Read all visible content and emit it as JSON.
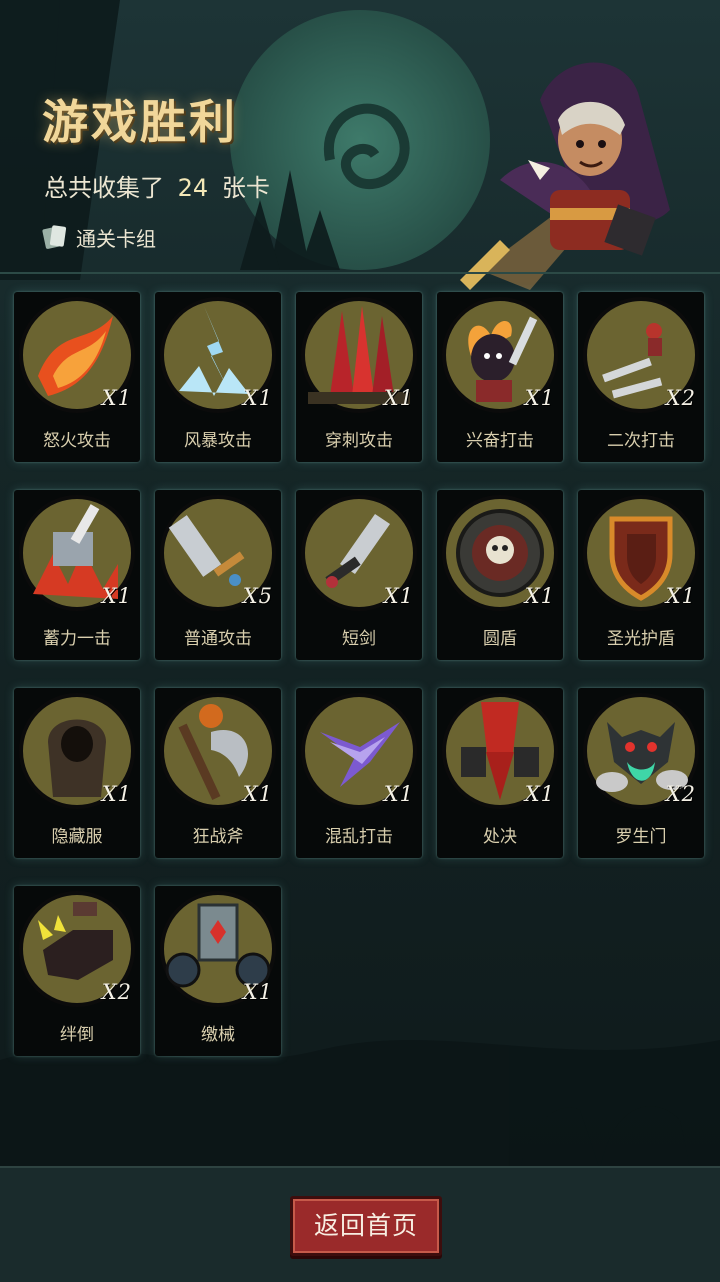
{
  "header": {
    "title": "游戏胜利",
    "summary_prefix": "总共收集了",
    "summary_count": "24",
    "summary_suffix": "张卡",
    "deck_link_label": "通关卡组"
  },
  "cards": [
    {
      "name": "怒火攻击",
      "qty": "X1",
      "icon": "flame-slash-icon"
    },
    {
      "name": "风暴攻击",
      "qty": "X1",
      "icon": "lightning-ice-icon"
    },
    {
      "name": "穿刺攻击",
      "qty": "X1",
      "icon": "spikes-icon"
    },
    {
      "name": "兴奋打击",
      "qty": "X1",
      "icon": "excited-rogue-icon"
    },
    {
      "name": "二次打击",
      "qty": "X2",
      "icon": "double-dagger-icon"
    },
    {
      "name": "蓄力一击",
      "qty": "X1",
      "icon": "hammer-smash-icon"
    },
    {
      "name": "普通攻击",
      "qty": "X5",
      "icon": "sword-icon"
    },
    {
      "name": "短剑",
      "qty": "X1",
      "icon": "short-sword-icon"
    },
    {
      "name": "圆盾",
      "qty": "X1",
      "icon": "round-shield-icon"
    },
    {
      "name": "圣光护盾",
      "qty": "X1",
      "icon": "holy-shield-icon"
    },
    {
      "name": "隐藏服",
      "qty": "X1",
      "icon": "hooded-cloak-icon"
    },
    {
      "name": "狂战斧",
      "qty": "X1",
      "icon": "battle-axe-icon"
    },
    {
      "name": "混乱打击",
      "qty": "X1",
      "icon": "chaos-claw-icon"
    },
    {
      "name": "处决",
      "qty": "X1",
      "icon": "execution-icon"
    },
    {
      "name": "罗生门",
      "qty": "X2",
      "icon": "demon-gate-icon"
    },
    {
      "name": "绊倒",
      "qty": "X2",
      "icon": "trip-boot-icon"
    },
    {
      "name": "缴械",
      "qty": "X1",
      "icon": "disarm-icon"
    }
  ],
  "footer": {
    "home_button_label": "返回首页"
  },
  "colors": {
    "title": "#f1d79a",
    "card_ring": "#6b6431",
    "button": "#9a2a2a"
  }
}
